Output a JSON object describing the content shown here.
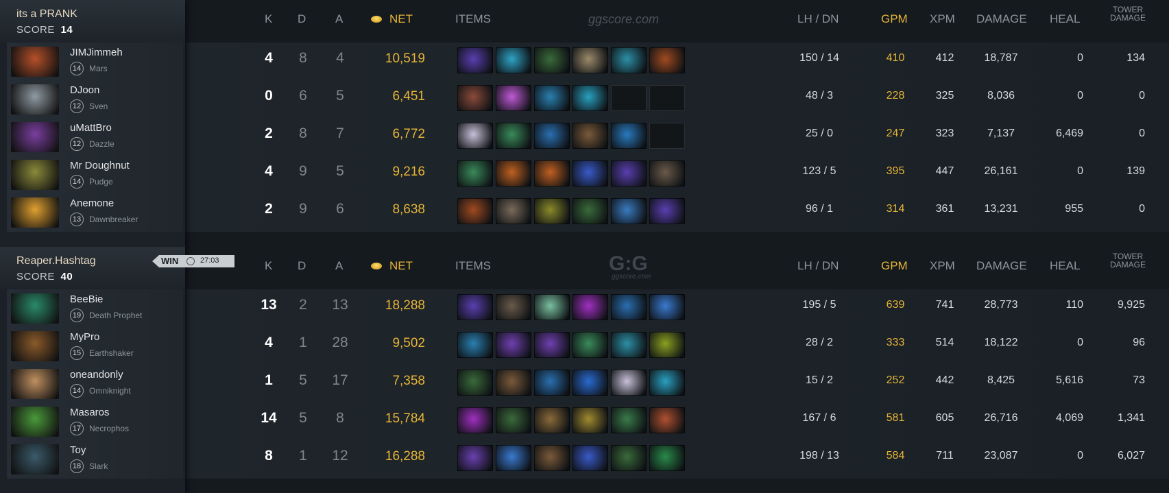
{
  "columns": {
    "k": "K",
    "d": "D",
    "a": "A",
    "net": "NET",
    "items": "ITEMS",
    "lhdn": "LH  /  DN",
    "gpm": "GPM",
    "xpm": "XPM",
    "damage": "DAMAGE",
    "heal": "HEAL",
    "tower1": "TOWER",
    "tower2": "DAMAGE"
  },
  "watermark1": "ggscore.com",
  "watermark2": "G:G",
  "watermark2sub": "ggscore.com",
  "teams": [
    {
      "name": "its a PRANK",
      "score_label": "SCORE",
      "score": "14",
      "players": [
        {
          "name": "JIMJimmeh",
          "level": "14",
          "hero": "Mars",
          "k": "4",
          "d": "8",
          "a": "4",
          "net": "10,519",
          "lhdn": "150  /  14",
          "gpm": "410",
          "xpm": "412",
          "damage": "18,787",
          "heal": "0",
          "tower": "134",
          "avatar_color": "#b5502a",
          "items": [
            "#5a3fb0",
            "#2fa3c6",
            "#3a6a3a",
            "#9c8a6a",
            "#2d8fa6",
            "#a04a20"
          ]
        },
        {
          "name": "DJoon",
          "level": "12",
          "hero": "Sven",
          "k": "0",
          "d": "6",
          "a": "5",
          "net": "6,451",
          "lhdn": "48  /  3",
          "gpm": "228",
          "xpm": "325",
          "damage": "8,036",
          "heal": "0",
          "tower": "0",
          "avatar_color": "#8f9aa2",
          "items": [
            "#8a4a3a",
            "#c05ad6",
            "#2a7fb0",
            "#2aa0c0",
            "empty",
            "empty"
          ]
        },
        {
          "name": "uMattBro",
          "level": "12",
          "hero": "Dazzle",
          "k": "2",
          "d": "8",
          "a": "7",
          "net": "6,772",
          "lhdn": "25  /  0",
          "gpm": "247",
          "xpm": "323",
          "damage": "7,137",
          "heal": "6,469",
          "tower": "0",
          "avatar_color": "#7a3fa0",
          "items": [
            "#c8c0d8",
            "#3a8a5a",
            "#2a6fb0",
            "#7a5a3a",
            "#2a7ac0",
            "empty"
          ]
        },
        {
          "name": "Mr Doughnut",
          "level": "14",
          "hero": "Pudge",
          "k": "4",
          "d": "9",
          "a": "5",
          "net": "9,216",
          "lhdn": "123  /  5",
          "gpm": "395",
          "xpm": "447",
          "damage": "26,161",
          "heal": "0",
          "tower": "139",
          "avatar_color": "#8a8a3a",
          "items": [
            "#3a8a5a",
            "#c06020",
            "#c06020",
            "#3a5ac8",
            "#5a3fb0",
            "#6a5a4a"
          ]
        },
        {
          "name": "Anemone",
          "level": "13",
          "hero": "Dawnbreaker",
          "k": "2",
          "d": "9",
          "a": "6",
          "net": "8,638",
          "lhdn": "96  /  1",
          "gpm": "314",
          "xpm": "361",
          "damage": "13,231",
          "heal": "955",
          "tower": "0",
          "avatar_color": "#e0a030",
          "items": [
            "#a04a20",
            "#7a6a5a",
            "#8a8a2a",
            "#3a6a3a",
            "#3a7ac0",
            "#5a3fb0"
          ]
        }
      ]
    },
    {
      "name": "Reaper.Hashtag",
      "score_label": "SCORE",
      "score": "40",
      "result": "WIN",
      "time": "27:03",
      "players": [
        {
          "name": "BeeBie",
          "level": "19",
          "hero": "Death Prophet",
          "k": "13",
          "d": "2",
          "a": "13",
          "net": "18,288",
          "lhdn": "195  /  5",
          "gpm": "639",
          "xpm": "741",
          "damage": "28,773",
          "heal": "110",
          "tower": "9,925",
          "avatar_color": "#2a8a6a",
          "items": [
            "#5a3fb0",
            "#6a5a4a",
            "#7ac0a0",
            "#a030c0",
            "#2a6fb0",
            "#3a7ad0"
          ]
        },
        {
          "name": "MyPro",
          "level": "15",
          "hero": "Earthshaker",
          "k": "4",
          "d": "1",
          "a": "28",
          "net": "9,502",
          "lhdn": "28  /  2",
          "gpm": "333",
          "xpm": "514",
          "damage": "18,122",
          "heal": "0",
          "tower": "96",
          "avatar_color": "#8a5a2a",
          "items": [
            "#2a7fb0",
            "#7040b0",
            "#7040b0",
            "#3a8a5a",
            "#2d8fa6",
            "#8aa020"
          ]
        },
        {
          "name": "oneandonly",
          "level": "14",
          "hero": "Omniknight",
          "k": "1",
          "d": "5",
          "a": "17",
          "net": "7,358",
          "lhdn": "15  /  2",
          "gpm": "252",
          "xpm": "442",
          "damage": "8,425",
          "heal": "5,616",
          "tower": "73",
          "avatar_color": "#c09060",
          "items": [
            "#3a6a3a",
            "#7a5a3a",
            "#2a6fb0",
            "#2a6ad0",
            "#c8c0d8",
            "#2aa0c0"
          ]
        },
        {
          "name": "Masaros",
          "level": "17",
          "hero": "Necrophos",
          "k": "14",
          "d": "5",
          "a": "8",
          "net": "15,784",
          "lhdn": "167  /  6",
          "gpm": "581",
          "xpm": "605",
          "damage": "26,716",
          "heal": "4,069",
          "tower": "1,341",
          "avatar_color": "#4a9a3a",
          "items": [
            "#a030c0",
            "#3a6a3a",
            "#8a6a3a",
            "#a08a30",
            "#3a7a4a",
            "#b05030"
          ]
        },
        {
          "name": "Toy",
          "level": "18",
          "hero": "Slark",
          "k": "8",
          "d": "1",
          "a": "12",
          "net": "16,288",
          "lhdn": "198  /  13",
          "gpm": "584",
          "xpm": "711",
          "damage": "23,087",
          "heal": "0",
          "tower": "6,027",
          "avatar_color": "#3a5a6a",
          "items": [
            "#6a40b0",
            "#3a7ad0",
            "#7a5a3a",
            "#3a5ac8",
            "#3a6a3a",
            "#2a8a4a"
          ]
        }
      ]
    }
  ]
}
